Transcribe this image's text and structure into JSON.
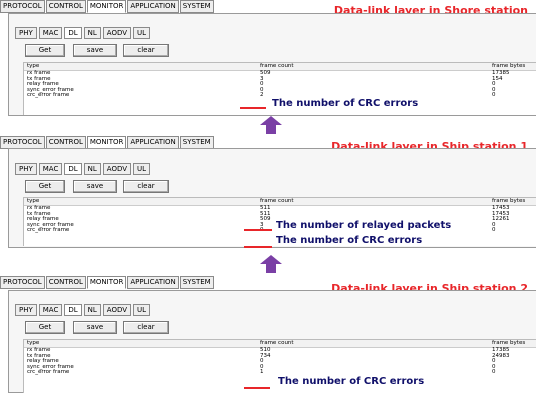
{
  "top_tabs": [
    "PROTOCOL",
    "CONTROL",
    "MONITOR",
    "APPLICATION",
    "SYSTEM"
  ],
  "active_top_tab": "MONITOR",
  "sub_tabs": [
    "PHY",
    "MAC",
    "DL",
    "NL",
    "AODV",
    "UL"
  ],
  "active_sub_tab": "DL",
  "buttons": {
    "get": "Get",
    "save": "save",
    "clear": "clear"
  },
  "columns": {
    "type": "type",
    "frame_count": "frame count",
    "frame_bytes": "frame bytes"
  },
  "panels": [
    {
      "title": "Data-link layer in Shore station",
      "rows": [
        {
          "type": "rx frame",
          "count": "509",
          "bytes": "17385"
        },
        {
          "type": "tx frame",
          "count": "3",
          "bytes": "154"
        },
        {
          "type": "relay frame",
          "count": "0",
          "bytes": "0"
        },
        {
          "type": "sync_error frame",
          "count": "0",
          "bytes": "0"
        },
        {
          "type": "crc_error frame",
          "count": "2",
          "bytes": "0"
        }
      ],
      "annotations": [
        {
          "text": "The number of CRC errors"
        }
      ]
    },
    {
      "title": "Data-link layer in Ship station 1",
      "rows": [
        {
          "type": "rx frame",
          "count": "511",
          "bytes": "17453"
        },
        {
          "type": "tx frame",
          "count": "511",
          "bytes": "17453"
        },
        {
          "type": "relay frame",
          "count": "509",
          "bytes": "12261"
        },
        {
          "type": "sync_error frame",
          "count": "3",
          "bytes": "0"
        },
        {
          "type": "crc_error frame",
          "count": "0",
          "bytes": "0"
        }
      ],
      "annotations": [
        {
          "text": "The number of relayed  packets"
        },
        {
          "text": "The number of CRC errors"
        }
      ]
    },
    {
      "title": "Data-link layer in Ship station 2",
      "rows": [
        {
          "type": "rx frame",
          "count": "510",
          "bytes": "17385"
        },
        {
          "type": "tx frame",
          "count": "734",
          "bytes": "24983"
        },
        {
          "type": "relay frame",
          "count": "0",
          "bytes": "0"
        },
        {
          "type": "sync_error frame",
          "count": "0",
          "bytes": "0"
        },
        {
          "type": "crc_error frame",
          "count": "1",
          "bytes": "0"
        }
      ],
      "annotations": [
        {
          "text": "The number of CRC errors"
        }
      ]
    }
  ],
  "colors": {
    "title": "#e8262a",
    "annotation": "#10106a",
    "arrow": "#7a3fa5",
    "underline": "#e8262a"
  },
  "icons": [
    "down-arrow-icon"
  ]
}
